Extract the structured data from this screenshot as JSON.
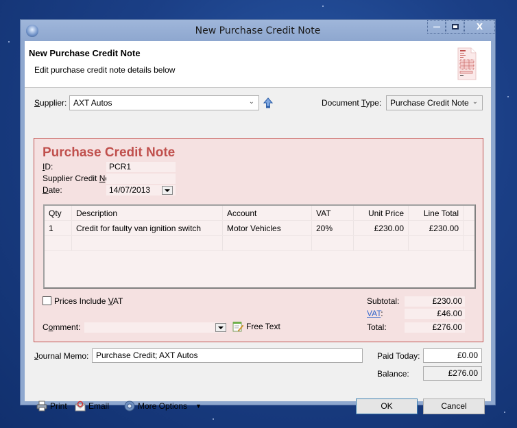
{
  "window": {
    "title": "New Purchase Credit Note",
    "controls": {
      "minimize": "minimize",
      "maximize": "maximize",
      "close": "X"
    }
  },
  "header": {
    "title": "New Purchase Credit Note",
    "subtitle": "Edit purchase credit note details below",
    "icon": "credit-note-document-icon"
  },
  "supplier": {
    "label_prefix": "",
    "label_access": "S",
    "label_rest": "upplier:",
    "value": "AXT Autos"
  },
  "document_type": {
    "label_pre": "Document ",
    "label_access": "T",
    "label_rest": "ype:",
    "value": "Purchase Credit Note"
  },
  "panel": {
    "title": "Purchase Credit Note",
    "accent_color": "#c0504d",
    "id": {
      "label_access": "I",
      "label_rest": "D:",
      "value": "PCR1"
    },
    "supplier_credit_no": {
      "label_pre": "Supplier Credit ",
      "label_access": "N",
      "label_rest": "o:",
      "value": ""
    },
    "date": {
      "label_access": "D",
      "label_rest": "ate:",
      "value": "14/07/2013"
    }
  },
  "grid": {
    "columns": [
      "Qty",
      "Description",
      "Account",
      "VAT",
      "Unit Price",
      "Line Total"
    ],
    "rows": [
      {
        "qty": "1",
        "description": "Credit for faulty van ignition switch",
        "account": "Motor Vehicles",
        "vat": "20%",
        "unit_price": "£230.00",
        "line_total": "£230.00"
      },
      {
        "qty": "",
        "description": "",
        "account": "",
        "vat": "",
        "unit_price": "",
        "line_total": ""
      }
    ]
  },
  "prices_include_vat": {
    "label_pre": "Prices Include ",
    "label_access": "V",
    "label_rest": "AT",
    "checked": false
  },
  "comment": {
    "label_pre": "C",
    "label_access": "o",
    "label_rest": "mment:",
    "value": "",
    "free_text_label": "Free Text"
  },
  "totals": {
    "subtotal_label": "Subtotal:",
    "subtotal": "£230.00",
    "vat_label": "VAT",
    "vat_colon": ":",
    "vat": "£46.00",
    "total_label": "Total:",
    "total": "£276.00"
  },
  "journal_memo": {
    "label_access": "J",
    "label_rest": "ournal Memo:",
    "value": "Purchase Credit; AXT Autos"
  },
  "paid_today": {
    "label": "Paid Today:",
    "value": "£0.00"
  },
  "balance": {
    "label": "Balance:",
    "value": "£276.00"
  },
  "toolbar": {
    "print": "Print",
    "email": "Email",
    "more_options": "More Options"
  },
  "buttons": {
    "ok": "OK",
    "cancel": "Cancel"
  }
}
